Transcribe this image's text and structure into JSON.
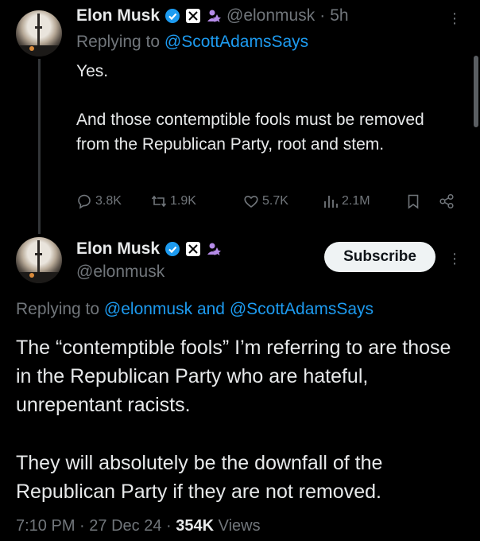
{
  "reply": {
    "author_name": "Elon Musk",
    "handle": "@elonmusk",
    "separator": "·",
    "time": "5h",
    "replying_prefix": "Replying to",
    "replying_to": "@ScottAdamsSays",
    "text_line1": "Yes.",
    "text_para2": "And those contemptible fools must be removed from the Republican Party, root and stem.",
    "replies": "3.8K",
    "reposts": "1.9K",
    "likes": "5.7K",
    "views": "2.1M"
  },
  "main": {
    "author_name": "Elon Musk",
    "handle": "@elonmusk",
    "subscribe_label": "Subscribe",
    "replying_prefix": "Replying to",
    "replying_to_1": "@elonmusk",
    "replying_and": "and",
    "replying_to_2": "@ScottAdamsSays",
    "para1": "The “contemptible fools” I’m referring to are those in the Republican Party who are hateful, unrepentant racists.",
    "para2": "They will absolutely be the downfall of the Republican Party if they are not removed.",
    "time": "7:10 PM",
    "date": "27 Dec 24",
    "dot": "·",
    "views_count": "354K",
    "views_label": "Views"
  },
  "colors": {
    "background": "#000000",
    "text": "#e7e9ea",
    "muted": "#71767b",
    "link": "#1d9bf0"
  }
}
